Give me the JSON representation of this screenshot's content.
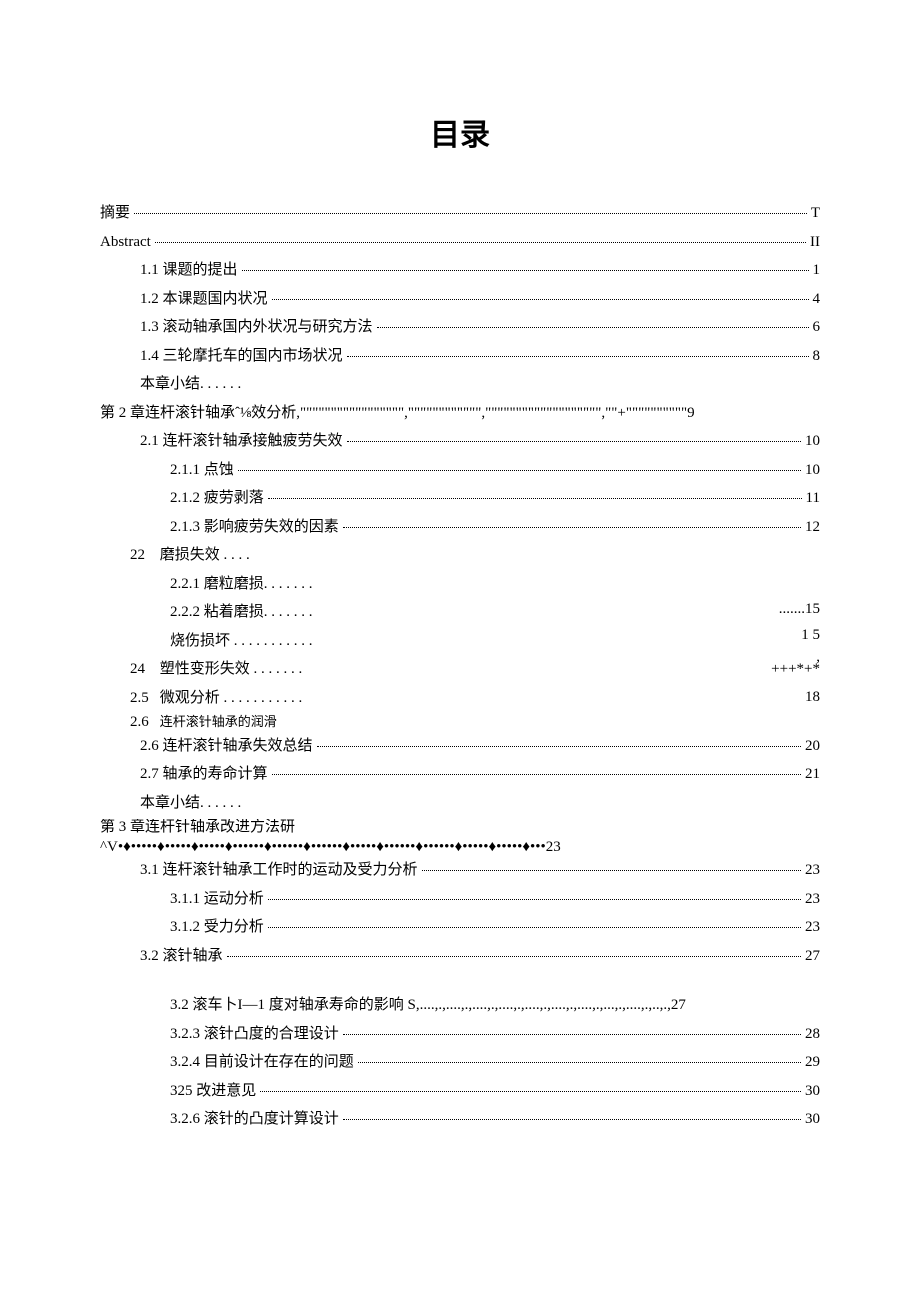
{
  "title": "目录",
  "lines": [
    {
      "type": "toc",
      "indent": "ind0",
      "label": "摘要",
      "page": "T"
    },
    {
      "type": "toc",
      "indent": "ind0",
      "label": "Abstract",
      "page": "II"
    },
    {
      "type": "toc",
      "indent": "ind1",
      "label": "1.1 课题的提出",
      "page": "1"
    },
    {
      "type": "toc",
      "indent": "ind1",
      "label": "1.2 本课题国内状况",
      "page": "4"
    },
    {
      "type": "toc",
      "indent": "ind1",
      "label": "1.3 滚动轴承国内外状况与研究方法",
      "page": "6"
    },
    {
      "type": "toc",
      "indent": "ind1",
      "label": "1.4 三轮摩托车的国内市场状况",
      "page": "8"
    },
    {
      "type": "raw",
      "indent": "ind1",
      "text": "本章小结. . . . . ."
    },
    {
      "type": "chapter",
      "text": "第 2 章连杆滚针轴承ˆ⅛效分析,\"\"\"\"\"\"\"\"\"\"\"\"\"\"\"\"\",\"\"\"\"\"\"\"\"\"\"\"\",\"\"\"\"\"\"\"\"\"\"\"\"\"\"\"\"\"\"\",\"\"+\"\"\"\"\"\"\"\"\"\"9"
    },
    {
      "type": "toc",
      "indent": "ind1",
      "label": "2.1 连杆滚针轴承接触疲劳失效",
      "page": "10"
    },
    {
      "type": "toc",
      "indent": "ind2",
      "label": "2.1.1 点蚀",
      "page": "10"
    },
    {
      "type": "toc",
      "indent": "ind2",
      "label": "2.1.2 疲劳剥落",
      "page": "11"
    },
    {
      "type": "toc",
      "indent": "ind2",
      "label": "2.1.3 影响疲劳失效的因素",
      "page": "12"
    },
    {
      "type": "raw",
      "indent": "ind2b",
      "text": "<span class='leftnum'>22</span>  磨损失效 . . . ."
    },
    {
      "type": "raw",
      "indent": "ind2",
      "text": "2.2.1 磨粒磨损. . . . . . ."
    },
    {
      "type": "bigstart"
    },
    {
      "type": "raw",
      "indent": "ind2",
      "text": "2.2.2 粘着磨损. . . . . . .",
      "right": ".......15",
      "rtop": "0"
    },
    {
      "type": "raw",
      "indent": "ind2",
      "text": "烧伤损坏 . . . . . . . . . . .",
      "right": "1 5",
      "rtop": "26"
    },
    {
      "type": "raw",
      "indent": "ind2b",
      "text": "<span class='leftnum'>24</span>   塑性变形失效 . . . . . . .",
      "right": ",",
      "rtop": "48"
    },
    {
      "type": "raw",
      "indent": "ind2b",
      "text": "<span class='leftnum'>2.5</span>   微观分析 . . . . . . . . . . .",
      "right": "+++*+*",
      "rtop": "60"
    },
    {
      "type": "smallraw",
      "indent": "ind2b",
      "text": "<span class='leftnum'>2.6</span>   <span style='font-size:13px;'>连杆滚针轴承的润滑</span>",
      "right": "18",
      "rtop": "88"
    },
    {
      "type": "bigend"
    },
    {
      "type": "toc",
      "indent": "ind1",
      "label": "2.6 连杆滚针轴承失效总结",
      "page": "20"
    },
    {
      "type": "toc",
      "indent": "ind1",
      "label": "2.7 轴承的寿命计算",
      "page": "21"
    },
    {
      "type": "raw",
      "indent": "ind1",
      "text": "本章小结. . . . . ."
    },
    {
      "type": "chapter2a",
      "text": "第 3 章连杆针轴承改进方法研"
    },
    {
      "type": "chapter2b",
      "text": "^V•♦•••••♦•••••♦•••••♦••••••♦••••••♦••••••♦•••••♦••••••♦••••••♦•••••♦•••••♦•••23"
    },
    {
      "type": "toc",
      "indent": "ind1",
      "label": "3.1 连杆滚针轴承工作时的运动及受力分析",
      "page": "23"
    },
    {
      "type": "toc",
      "indent": "ind2",
      "label": "3.1.1 运动分析",
      "page": "23"
    },
    {
      "type": "toc",
      "indent": "ind2",
      "label": "3.1.2 受力分析",
      "page": "23"
    },
    {
      "type": "toc",
      "indent": "ind1",
      "label": "3.2 滚针轴承",
      "page": "27"
    },
    {
      "type": "gap"
    },
    {
      "type": "raw",
      "indent": "ind2",
      "text": "3.2 滚车卜I—1 度对轴承寿命的影响 S,....,.,....,.,....,.,....,.,....,.,....,.,....,.,...,.,....,.,..,.,27"
    },
    {
      "type": "toc",
      "indent": "ind2",
      "label": "3.2.3 滚针凸度的合理设计",
      "page": "28"
    },
    {
      "type": "toc",
      "indent": "ind2",
      "label": "3.2.4 目前设计在存在的问题",
      "page": "29"
    },
    {
      "type": "toc",
      "indent": "ind2",
      "label": "325 改进意见",
      "page": "30"
    },
    {
      "type": "toc",
      "indent": "ind2",
      "label": "3.2.6 滚针的凸度计算设计",
      "page": "30"
    }
  ]
}
